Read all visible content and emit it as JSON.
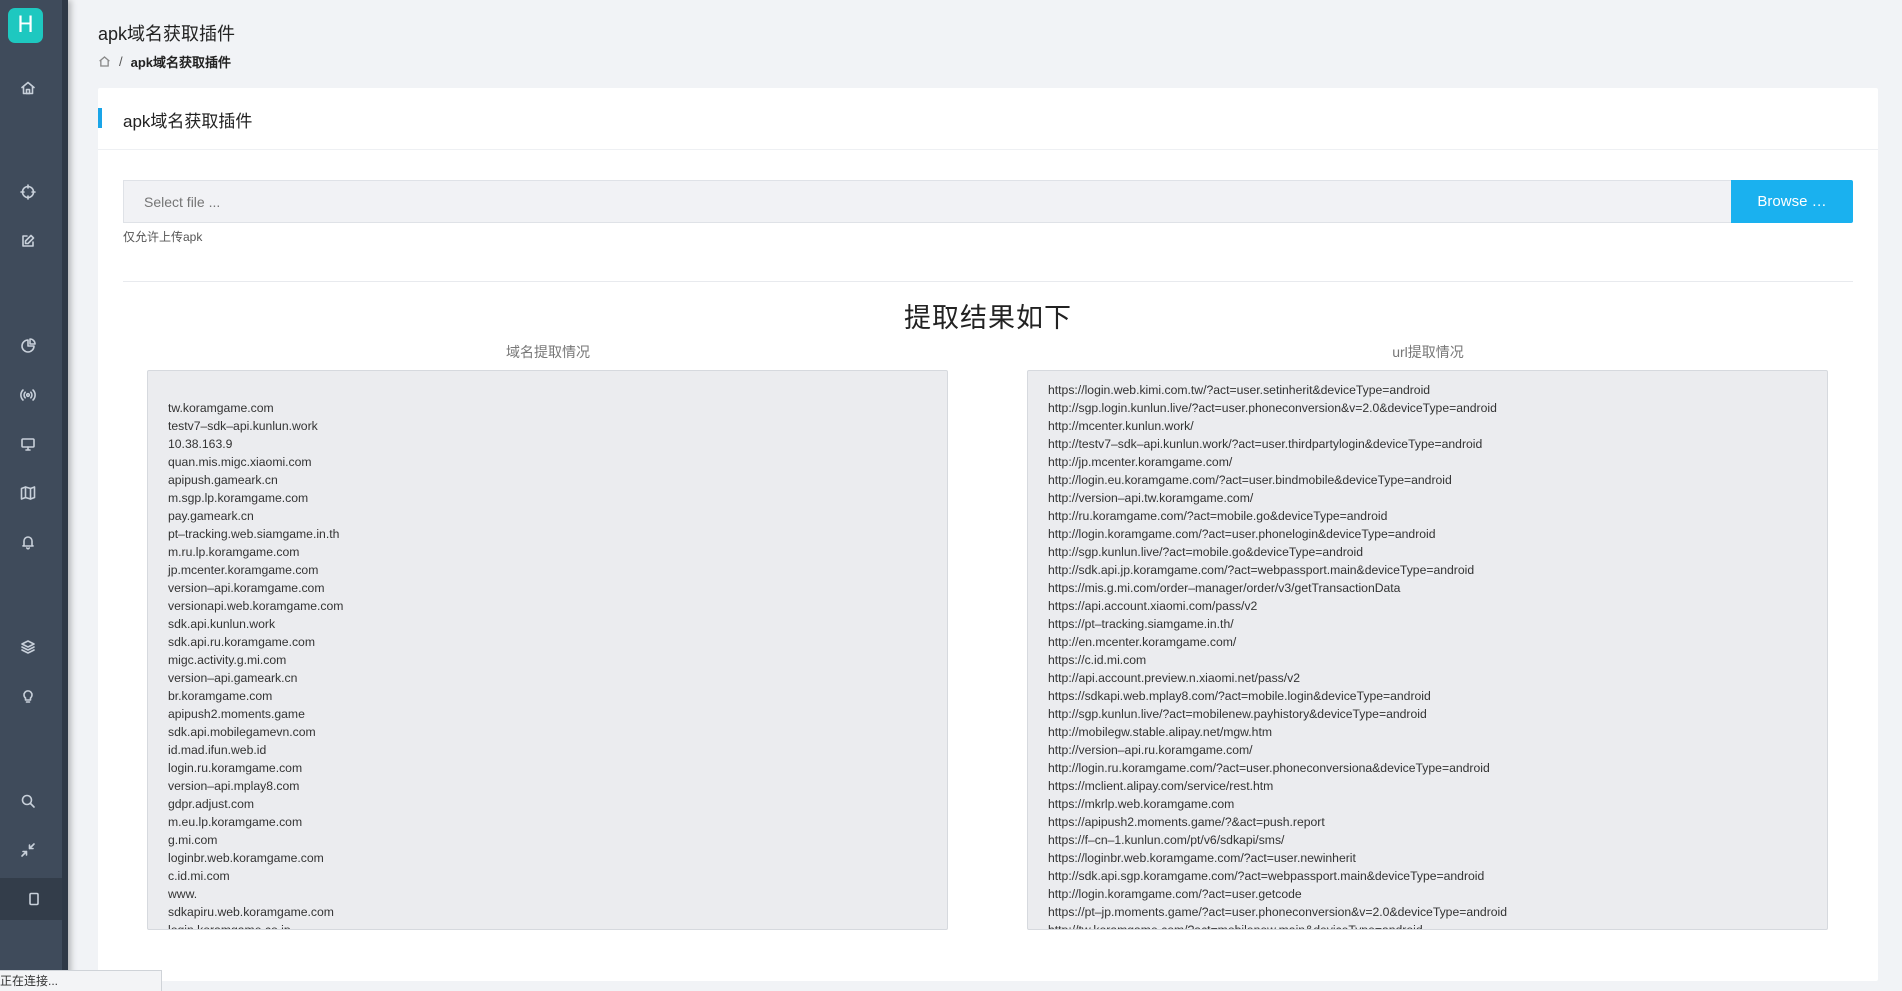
{
  "app": {
    "logo_letter": "H",
    "page_title": "apk域名获取插件",
    "breadcrumb": {
      "current": "apk域名获取插件"
    }
  },
  "sidebar": {
    "items": [
      {
        "icon": "home-icon"
      },
      {
        "icon": "crosshair-icon"
      },
      {
        "icon": "edit-icon"
      },
      {
        "icon": "pie-chart-icon"
      },
      {
        "icon": "broadcast-icon"
      },
      {
        "icon": "monitor-icon"
      },
      {
        "icon": "map-icon"
      },
      {
        "icon": "bell-icon"
      },
      {
        "icon": "layers-icon"
      },
      {
        "icon": "lightbulb-icon"
      },
      {
        "icon": "search-icon"
      },
      {
        "icon": "minimize-icon"
      },
      {
        "icon": "tablet-icon"
      }
    ]
  },
  "card": {
    "title": "apk域名获取插件",
    "file_placeholder": "Select file ...",
    "browse_label": "Browse …",
    "hint": "仅允许上传apk",
    "result_title": "提取结果如下",
    "domain_label": "域名提取情况",
    "url_label": "url提取情况",
    "accent_color": "#1ab1ef"
  },
  "domains": [
    "",
    "tw.koramgame.com",
    "testv7–sdk–api.kunlun.work",
    "10.38.163.9",
    "quan.mis.migc.xiaomi.com",
    "apipush.gameark.cn",
    "m.sgp.lp.koramgame.com",
    "pay.gameark.cn",
    "pt–tracking.web.siamgame.in.th",
    "m.ru.lp.koramgame.com",
    "jp.mcenter.koramgame.com",
    "version–api.koramgame.com",
    "versionapi.web.koramgame.com",
    "sdk.api.kunlun.work",
    "sdk.api.ru.koramgame.com",
    "migc.activity.g.mi.com",
    "version–api.gameark.cn",
    "br.koramgame.com",
    "apipush2.moments.game",
    "sdk.api.mobilegamevn.com",
    "id.mad.ifun.web.id",
    "login.ru.koramgame.com",
    "version–api.mplay8.com",
    "gdpr.adjust.com",
    "m.eu.lp.koramgame.com",
    "g.mi.com",
    "loginbr.web.koramgame.com",
    "c.id.mi.com",
    "www.",
    "sdkapiru.web.koramgame.com",
    "login.koramgame.co.jp"
  ],
  "urls": [
    "https://login.web.kimi.com.tw/?act=user.setinherit&deviceType=android",
    "http://sgp.login.kunlun.live/?act=user.phoneconversion&v=2.0&deviceType=android",
    "http://mcenter.kunlun.work/",
    "http://testv7–sdk–api.kunlun.work/?act=user.thirdpartylogin&deviceType=android",
    "http://jp.mcenter.koramgame.com/",
    "http://login.eu.koramgame.com/?act=user.bindmobile&deviceType=android",
    "http://version–api.tw.koramgame.com/",
    "http://ru.koramgame.com/?act=mobile.go&deviceType=android",
    "http://login.koramgame.com/?act=user.phonelogin&deviceType=android",
    "http://sgp.kunlun.live/?act=mobile.go&deviceType=android",
    "http://sdk.api.jp.koramgame.com/?act=webpassport.main&deviceType=android",
    "https://mis.g.mi.com/order–manager/order/v3/getTransactionData",
    "https://api.account.xiaomi.com/pass/v2",
    "https://pt–tracking.siamgame.in.th/",
    "http://en.mcenter.koramgame.com/",
    "https://c.id.mi.com",
    "http://api.account.preview.n.xiaomi.net/pass/v2",
    "https://sdkapi.web.mplay8.com/?act=mobile.login&deviceType=android",
    "http://sgp.kunlun.live/?act=mobilenew.payhistory&deviceType=android",
    "http://mobilegw.stable.alipay.net/mgw.htm",
    "http://version–api.ru.koramgame.com/",
    "http://login.ru.koramgame.com/?act=user.phoneconversiona&deviceType=android",
    "https://mclient.alipay.com/service/rest.htm",
    "https://mkrlp.web.koramgame.com",
    "https://apipush2.moments.game/?&act=push.report",
    "https://f–cn–1.kunlun.com/pt/v6/sdkapi/sms/",
    "https://loginbr.web.koramgame.com/?act=user.newinherit",
    "http://sdk.api.sgp.koramgame.com/?act=webpassport.main&deviceType=android",
    "http://login.koramgame.com/?act=user.getcode",
    "https://pt–jp.moments.game/?act=user.phoneconversion&v=2.0&deviceType=android",
    "http://tw.koramgame.com/?act=mobilenew.main&deviceType=android"
  ],
  "status": {
    "text": "正在连接..."
  }
}
